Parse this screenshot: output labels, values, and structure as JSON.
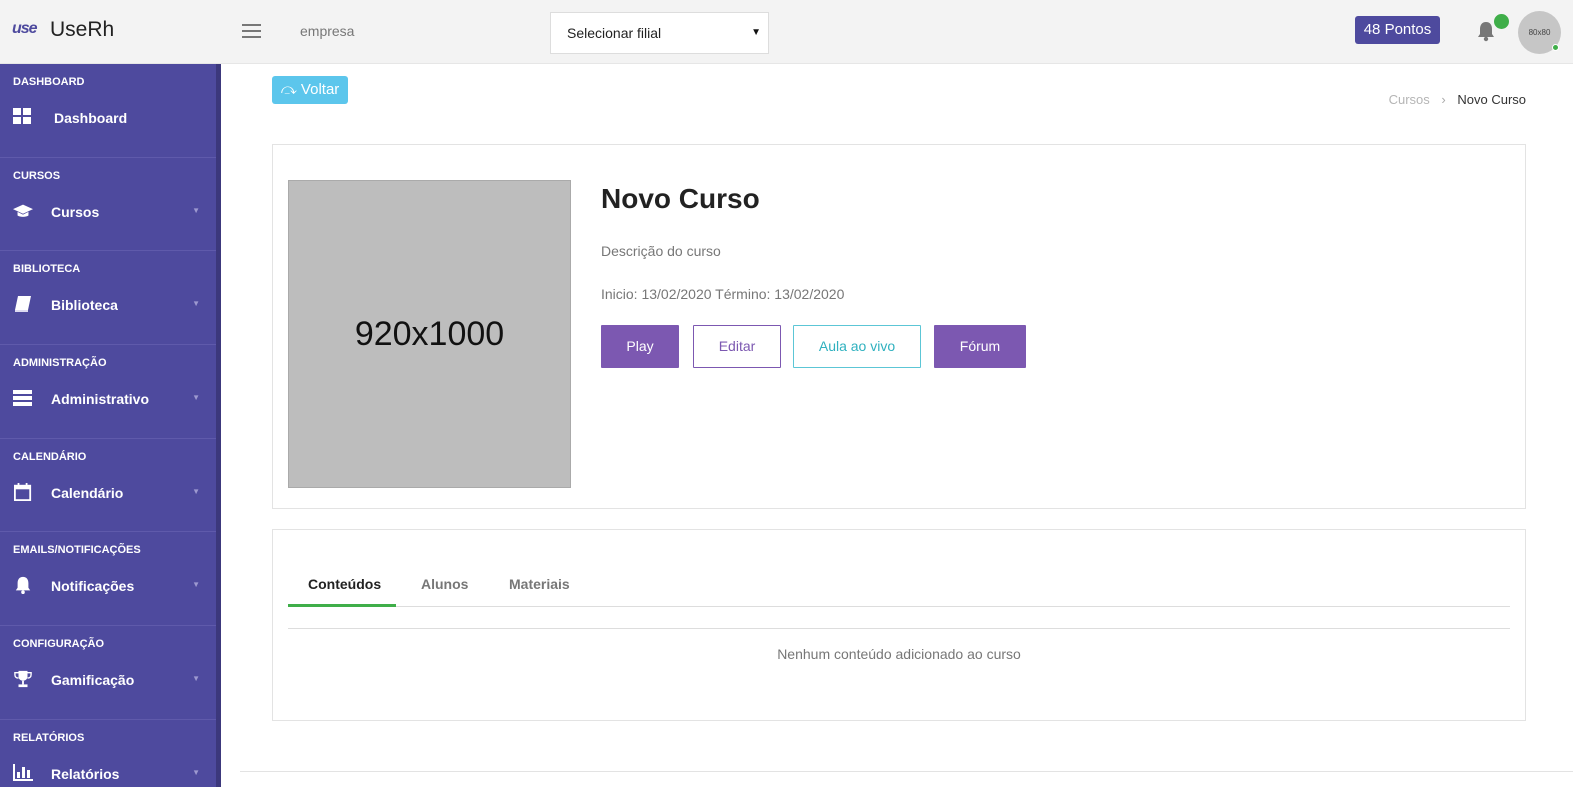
{
  "app": {
    "logo_mark": "use",
    "name": "UseRh"
  },
  "header": {
    "company": "empresa",
    "filial_select": "Selecionar filial",
    "points": "48 Pontos",
    "avatar": "80x80"
  },
  "sidebar": {
    "sections": [
      {
        "title": "DASHBOARD",
        "label": "Dashboard",
        "icon": "dashboard-icon",
        "caret": false
      },
      {
        "title": "CURSOS",
        "label": "Cursos",
        "icon": "graduation-cap-icon",
        "caret": true
      },
      {
        "title": "BIBLIOTECA",
        "label": "Biblioteca",
        "icon": "book-icon",
        "caret": true
      },
      {
        "title": "ADMINISTRAÇÃO",
        "label": "Administrativo",
        "icon": "server-icon",
        "caret": true
      },
      {
        "title": "CALENDÁRIO",
        "label": "Calendário",
        "icon": "calendar-icon",
        "caret": true
      },
      {
        "title": "EMAILS/NOTIFICAÇÕES",
        "label": "Notificações",
        "icon": "bell-icon",
        "caret": true
      },
      {
        "title": "CONFIGURAÇÃO",
        "label": "Gamificação",
        "icon": "trophy-icon",
        "caret": true
      },
      {
        "title": "RELATÓRIOS",
        "label": "Relatórios",
        "icon": "bar-chart-icon",
        "caret": true
      }
    ]
  },
  "page": {
    "back_label": "Voltar",
    "breadcrumb": {
      "parent": "Cursos",
      "current": "Novo Curso"
    }
  },
  "course": {
    "image_placeholder": "920x1000",
    "title": "Novo Curso",
    "description": "Descrição do curso",
    "dates": "Inicio: 13/02/2020 Término: 13/02/2020",
    "buttons": {
      "play": "Play",
      "edit": "Editar",
      "live": "Aula ao vivo",
      "forum": "Fórum"
    }
  },
  "tabs": {
    "items": [
      "Conteúdos",
      "Alunos",
      "Materiais"
    ],
    "empty_message": "Nenhum conteúdo adicionado ao curso"
  },
  "colors": {
    "primary": "#4e4a9e",
    "accent": "#7c58b1",
    "info": "#5cc6ec",
    "success": "#3fae49"
  }
}
